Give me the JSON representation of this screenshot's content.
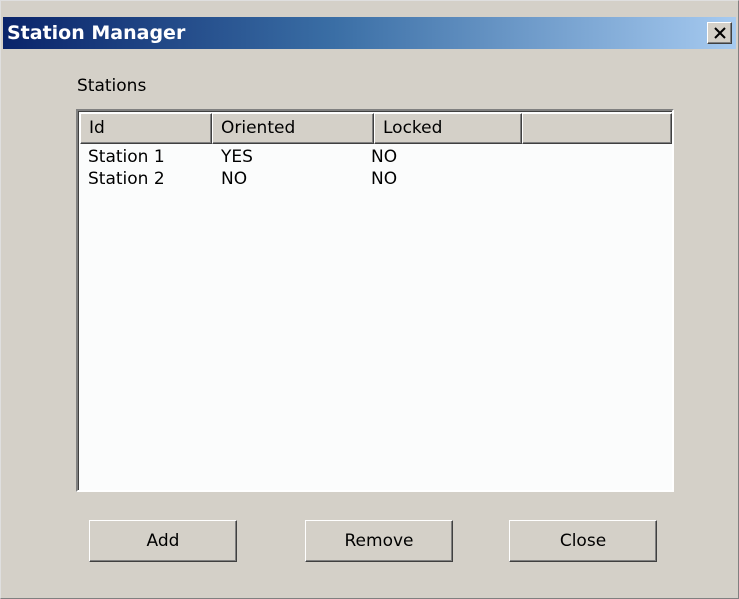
{
  "window": {
    "title": "Station Manager"
  },
  "stations": {
    "group_label": "Stations",
    "columns": [
      "Id",
      "Oriented",
      "Locked",
      ""
    ],
    "rows": [
      {
        "id": "Station 1",
        "oriented": "YES",
        "locked": "NO"
      },
      {
        "id": "Station 2",
        "oriented": "NO",
        "locked": "NO"
      }
    ]
  },
  "buttons": {
    "add": "Add",
    "remove": "Remove",
    "close": "Close"
  },
  "icons": {
    "close": "close-x-icon"
  },
  "colors": {
    "titlebar_start": "#0a246a",
    "titlebar_end": "#a6caf0",
    "dialog_face": "#d4d0c8",
    "list_background": "#fbfcfc"
  }
}
